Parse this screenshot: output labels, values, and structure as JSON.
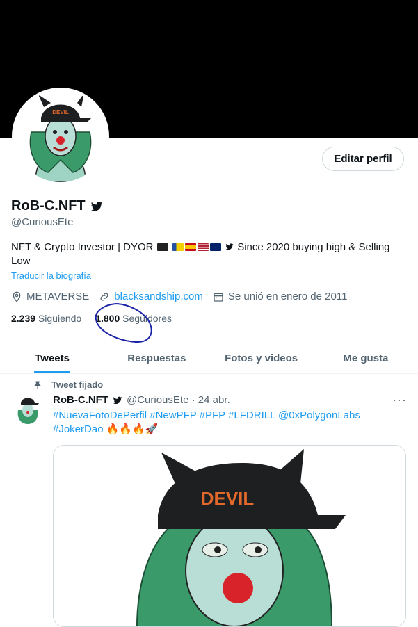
{
  "profile": {
    "name": "RoB-C.NFT",
    "handle": "@CuriousEte",
    "edit_label": "Editar perfil",
    "bio_text": "NFT & Crypto Investor | DYOR",
    "bio_end": "Since 2020 buying high & Selling Low",
    "translate_label": "Traducir la biografía",
    "location": "METAVERSE",
    "website": "blacksandship.com",
    "joined": "Se unió en enero de 2011",
    "following_count": "2.239",
    "following_label": "Siguiendo",
    "followers_count": "1.800",
    "followers_label": "Seguidores"
  },
  "tabs": [
    "Tweets",
    "Respuestas",
    "Fotos y videos",
    "Me gusta"
  ],
  "pinned_tweet": {
    "label": "Tweet fijado",
    "author": "RoB-C.NFT",
    "handle_date": "@CuriousEte · 24 abr.",
    "text_line1": "#NuevaFotoDePerfil #NewPFP #PFP #LFDRILL @0xPolygonLabs",
    "text_line2": "#JokerDao 🔥🔥🔥🚀",
    "more_label": "···"
  },
  "avatar_cap_text": "DEVIL",
  "colors": {
    "accent": "#1d9bf0",
    "banner": "#000000",
    "annotation": "#1a22a8"
  }
}
